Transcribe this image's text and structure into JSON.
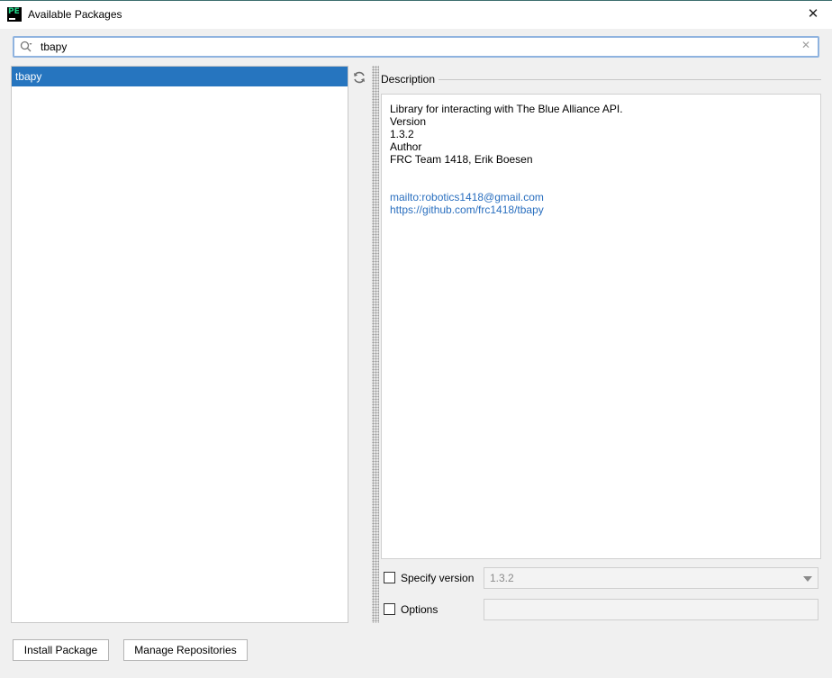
{
  "window": {
    "title": "Available Packages",
    "app_icon_text": "PE",
    "close_glyph": "✕"
  },
  "search": {
    "value": "tbapy",
    "clear_glyph": "✕"
  },
  "packages": {
    "items": [
      {
        "label": "tbapy",
        "selected": true
      }
    ]
  },
  "description": {
    "label": "Description",
    "lines": [
      "Library for interacting with The Blue Alliance API.",
      "Version",
      "1.3.2",
      "Author",
      "FRC Team 1418, Erik Boesen"
    ],
    "links": [
      "mailto:robotics1418@gmail.com",
      "https://github.com/frc1418/tbapy"
    ]
  },
  "options": {
    "specify_version_label": "Specify version",
    "specify_version_checked": false,
    "version_value": "1.3.2",
    "options_label": "Options",
    "options_checked": false,
    "options_value": ""
  },
  "buttons": {
    "install": "Install Package",
    "manage": "Manage Repositories"
  },
  "colors": {
    "selection": "#2675bf",
    "link": "#2a6fbf",
    "search_border": "#8fb3df"
  }
}
